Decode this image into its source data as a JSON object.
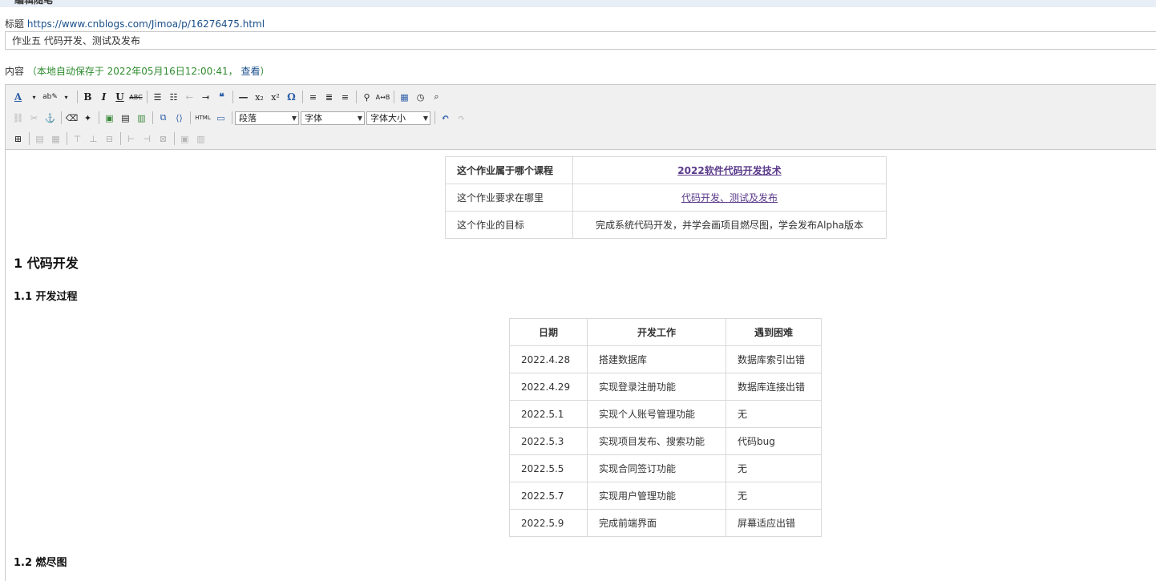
{
  "banner": {
    "label": "编辑随笔"
  },
  "post": {
    "title_label": "标题",
    "url": "https://www.cnblogs.com/Jimoa/p/16276475.html",
    "title_value": "作业五 代码开发、测试及发布"
  },
  "content": {
    "label": "内容",
    "autosave": "（本地自动保存于 2022年05月16日12:00:41，",
    "view_link": "查看",
    "close_paren": "）"
  },
  "toolbar": {
    "format_select": "段落",
    "font_select": "字体",
    "size_select": "字体大小",
    "html_label": "HTML"
  },
  "info_table": {
    "rows": [
      {
        "label": "这个作业属于哪个课程",
        "value": "2022软件代码开发技术"
      },
      {
        "label": "这个作业要求在哪里",
        "value": "代码开发、测试及发布"
      },
      {
        "label": "这个作业的目标",
        "value": "完成系统代码开发，并学会画项目燃尽图，学会发布Alpha版本"
      }
    ]
  },
  "headings": {
    "h1": "1 代码开发",
    "h2a": "1.1 开发过程",
    "h2b": "1.2 燃尽图"
  },
  "dev_table": {
    "headers": [
      "日期",
      "开发工作",
      "遇到困难"
    ],
    "rows": [
      [
        "2022.4.28",
        "搭建数据库",
        "数据库索引出错"
      ],
      [
        "2022.4.29",
        "实现登录注册功能",
        "数据库连接出错"
      ],
      [
        "2022.5.1",
        "实现个人账号管理功能",
        "无"
      ],
      [
        "2022.5.3",
        "实现项目发布、搜索功能",
        "代码bug"
      ],
      [
        "2022.5.5",
        "实现合同签订功能",
        "无"
      ],
      [
        "2022.5.7",
        "实现用户管理功能",
        "无"
      ],
      [
        "2022.5.9",
        "完成前端界面",
        "屏幕适应出错"
      ]
    ]
  }
}
